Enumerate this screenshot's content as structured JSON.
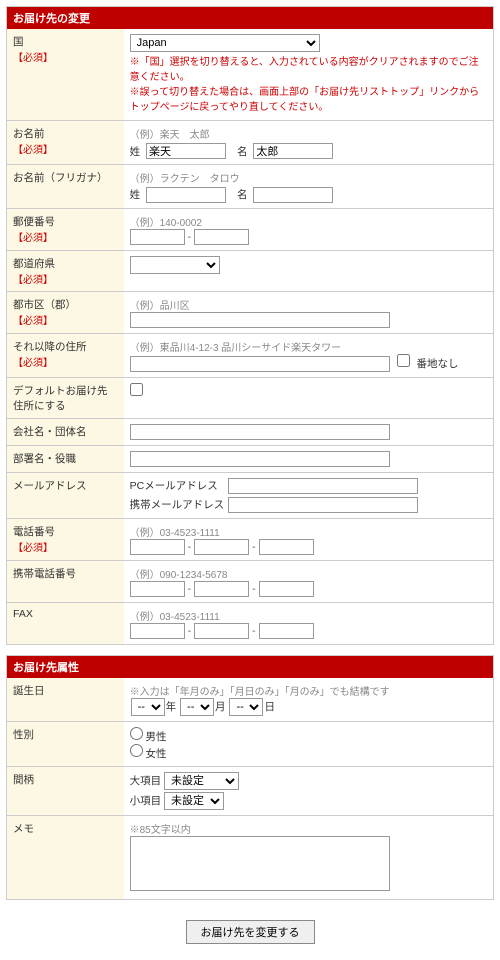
{
  "sections": {
    "edit": "お届け先の変更",
    "attr": "お届け先属性"
  },
  "labels": {
    "country": "国",
    "name": "お名前",
    "kana": "お名前（フリガナ）",
    "postal": "郵便番号",
    "pref": "都道府県",
    "city": "都市区（郡）",
    "addr": "それ以降の住所",
    "default": "デフォルトお届け先住所にする",
    "company": "会社名・団体名",
    "dept": "部署名・役職",
    "mail": "メールアドレス",
    "tel": "電話番号",
    "mobile": "携帯電話番号",
    "fax": "FAX",
    "birthday": "誕生日",
    "gender": "性別",
    "relation": "間柄",
    "memo": "メモ",
    "required": "【必須】",
    "lastname": "姓",
    "firstname": "名",
    "addr_none": "番地なし",
    "pcmail": "PCメールアドレス",
    "mbmail": "携帯メールアドレス",
    "year": "年",
    "month": "月",
    "day": "日",
    "male": "男性",
    "female": "女性",
    "rel_big": "大項目",
    "rel_small": "小項目"
  },
  "hints": {
    "name": "（例）楽天　太郎",
    "kana": "（例）ラクテン　タロウ",
    "postal": "（例）140-0002",
    "city": "（例）品川区",
    "addr": "（例）東品川4-12-3 品川シーサイド楽天タワー",
    "tel": "（例）03-4523-1111",
    "mobile": "（例）090-1234-5678",
    "fax": "（例）03-4523-1111",
    "birthday": "※入力は「年月のみ」「月日のみ」「月のみ」でも結構です",
    "memo": "※85文字以内"
  },
  "warnings": {
    "w1": "※「国」選択を切り替えると、入力されている内容がクリアされますのでご注意ください。",
    "w2": "※誤って切り替えた場合は、画面上部の「お届け先リストトップ」リンクからトップページに戻ってやり直してください。"
  },
  "values": {
    "country": "Japan",
    "lastname": "楽天",
    "firstname": "太郎",
    "bd_empty": "--",
    "rel_big": "未設定",
    "rel_small": "未設定"
  },
  "submit": "お届け先を変更する"
}
